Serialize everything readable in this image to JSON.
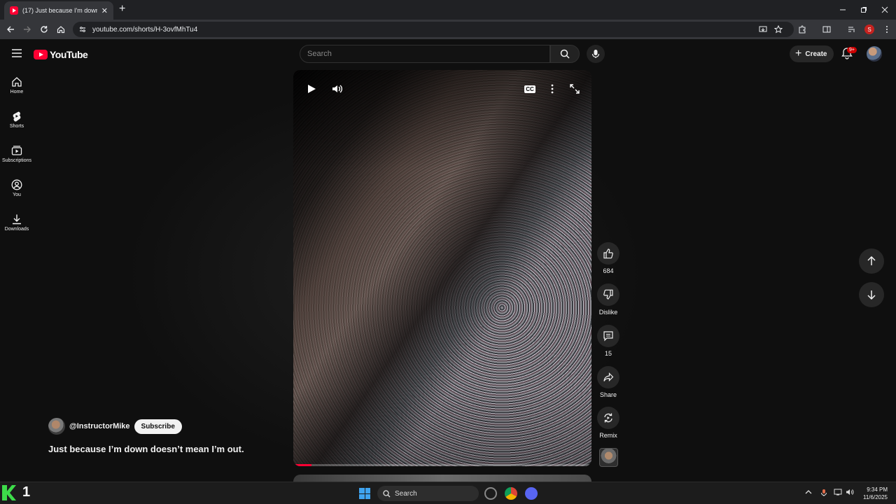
{
  "browser": {
    "tab_title": "(17) Just because I'm down do",
    "tab_close": "✕",
    "new_tab": "+",
    "url": "youtube.com/shorts/H-3ovfMhTu4",
    "profile_initial": "S"
  },
  "masthead": {
    "logo_text": "YouTube",
    "search_placeholder": "Search",
    "create_label": "Create",
    "notification_badge": "9+"
  },
  "sidebar": {
    "items": [
      {
        "label": "Home"
      },
      {
        "label": "Shorts"
      },
      {
        "label": "Subscriptions"
      },
      {
        "label": "You"
      },
      {
        "label": "Downloads"
      }
    ]
  },
  "short": {
    "channel": "@InstructorMike",
    "subscribe_label": "Subscribe",
    "title": "Just because I’m down doesn’t mean I’m out.",
    "progress": 0.06,
    "cc_label": "CC"
  },
  "actions": {
    "like_count": "684",
    "dislike_label": "Dislike",
    "comment_count": "15",
    "share_label": "Share",
    "remix_label": "Remix"
  },
  "taskbar": {
    "k_number": "1",
    "search_label": "Search",
    "time": "9:34 PM",
    "date": "11/6/2025"
  },
  "colors": {
    "brand_red": "#ff0033",
    "background": "#0f0f0f",
    "button_bg": "#272727"
  }
}
